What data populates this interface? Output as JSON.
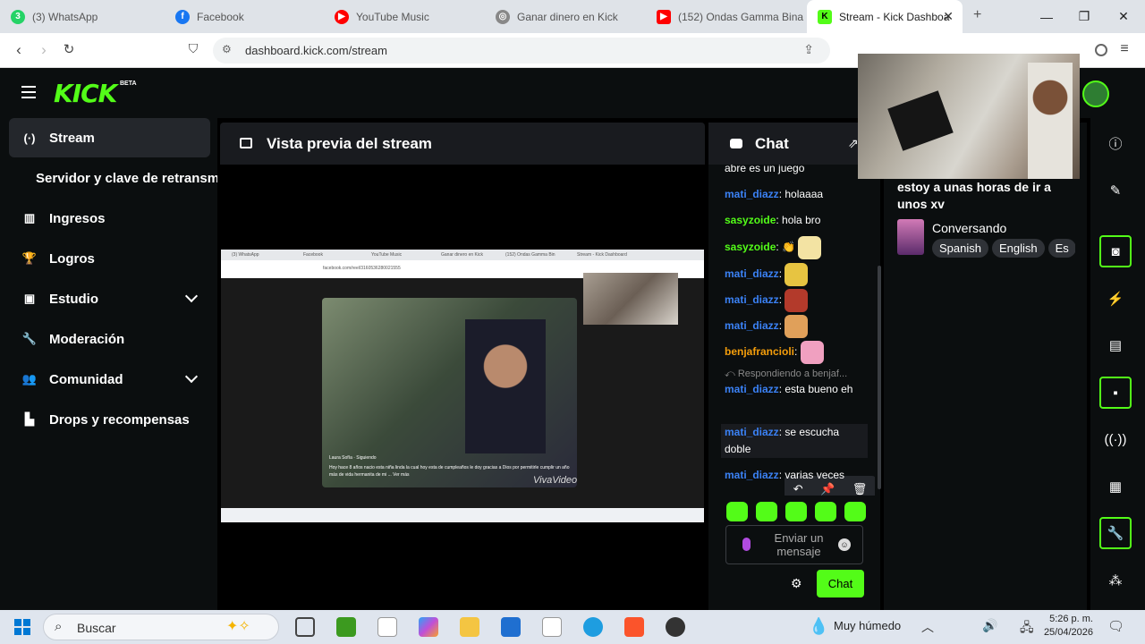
{
  "browser": {
    "tabs": [
      {
        "label": "(3) WhatsApp",
        "color": "#25d366"
      },
      {
        "label": "Facebook",
        "color": "#1877f2"
      },
      {
        "label": "YouTube Music",
        "color": "#ff0000"
      },
      {
        "label": "Ganar dinero en Kick",
        "color": "#777777"
      },
      {
        "label": "(152) Ondas Gamma Bina",
        "color": "#ff0000"
      },
      {
        "label": "Stream - Kick Dashboa",
        "color": "#53fc18"
      }
    ],
    "url": "dashboard.kick.com/stream"
  },
  "kick": {
    "logo": "KICK",
    "beta": "BETA",
    "accent": "#53fc18"
  },
  "sidebar": {
    "items": [
      {
        "icon": "(·)",
        "label": "Stream"
      },
      {
        "icon": "",
        "label": "Servidor y clave de retransm"
      },
      {
        "icon": "▥",
        "label": "Ingresos"
      },
      {
        "icon": "🏆",
        "label": "Logros"
      },
      {
        "icon": "▣",
        "label": "Estudio"
      },
      {
        "icon": "🔧",
        "label": "Moderación"
      },
      {
        "icon": "👥",
        "label": "Comunidad"
      },
      {
        "icon": "▙",
        "label": "Drops y recompensas"
      }
    ]
  },
  "preview": {
    "title": "Vista previa del stream",
    "shot_caption": "Hoy hace 8 años nacio esta niña linda la cual hoy esta de cumpleaños le doy gracias a Dios por permitirle cumplir un año más de vida hermanita de mi ... Ver más",
    "shot_user": "Laura Sofía · Siguiendo",
    "shot_watermark": "VivaVideo",
    "shot_tabs": [
      "(3) WhatsApp",
      "Facebook",
      "YouTube Music",
      "Ganar dinero en Kick",
      "(152) Ondas Gamma Bin",
      "Stream - Kick Dashboard"
    ],
    "shot_url": "facebook.com/reel/3160536280021555"
  },
  "chat": {
    "title": "Chat",
    "messages": [
      {
        "user": "",
        "text": "abre es un juego",
        "color": "#ffffff"
      },
      {
        "user": "mati_diazz",
        "text": ": holaaaa",
        "color": "#3b82f6"
      },
      {
        "user": "sasyzoide",
        "text": ": hola bro",
        "color": "#53fc18"
      },
      {
        "user": "sasyzoide",
        "text": ": 👏",
        "color": "#53fc18"
      },
      {
        "user": "mati_diazz",
        "text": ":",
        "color": "#3b82f6"
      },
      {
        "user": "mati_diazz",
        "text": ":",
        "color": "#3b82f6"
      },
      {
        "user": "mati_diazz",
        "text": ":",
        "color": "#3b82f6"
      },
      {
        "user": "benjafrancioli",
        "text": ":",
        "color": "#f59e0b"
      },
      {
        "user": "mati_diazz",
        "text": ": esta bueno eh",
        "color": "#3b82f6"
      },
      {
        "user": "mati_diazz",
        "text": ": se escucha doble",
        "color": "#3b82f6"
      },
      {
        "user": "mati_diazz",
        "text": ": varias veces",
        "color": "#3b82f6"
      }
    ],
    "reply_text": "Respondiendo a benjaf...",
    "input_placeholder": "Enviar un mensaje",
    "send_label": "Chat"
  },
  "info": {
    "stream_title": "estoy a unas horas de ir a unos xv",
    "category": "Conversando",
    "tags": [
      "Spanish",
      "English",
      "Es"
    ]
  },
  "taskbar": {
    "search_placeholder": "Buscar",
    "weather": "Muy húmedo",
    "time": "5:26 p. m.",
    "date": "25/04/2026"
  }
}
